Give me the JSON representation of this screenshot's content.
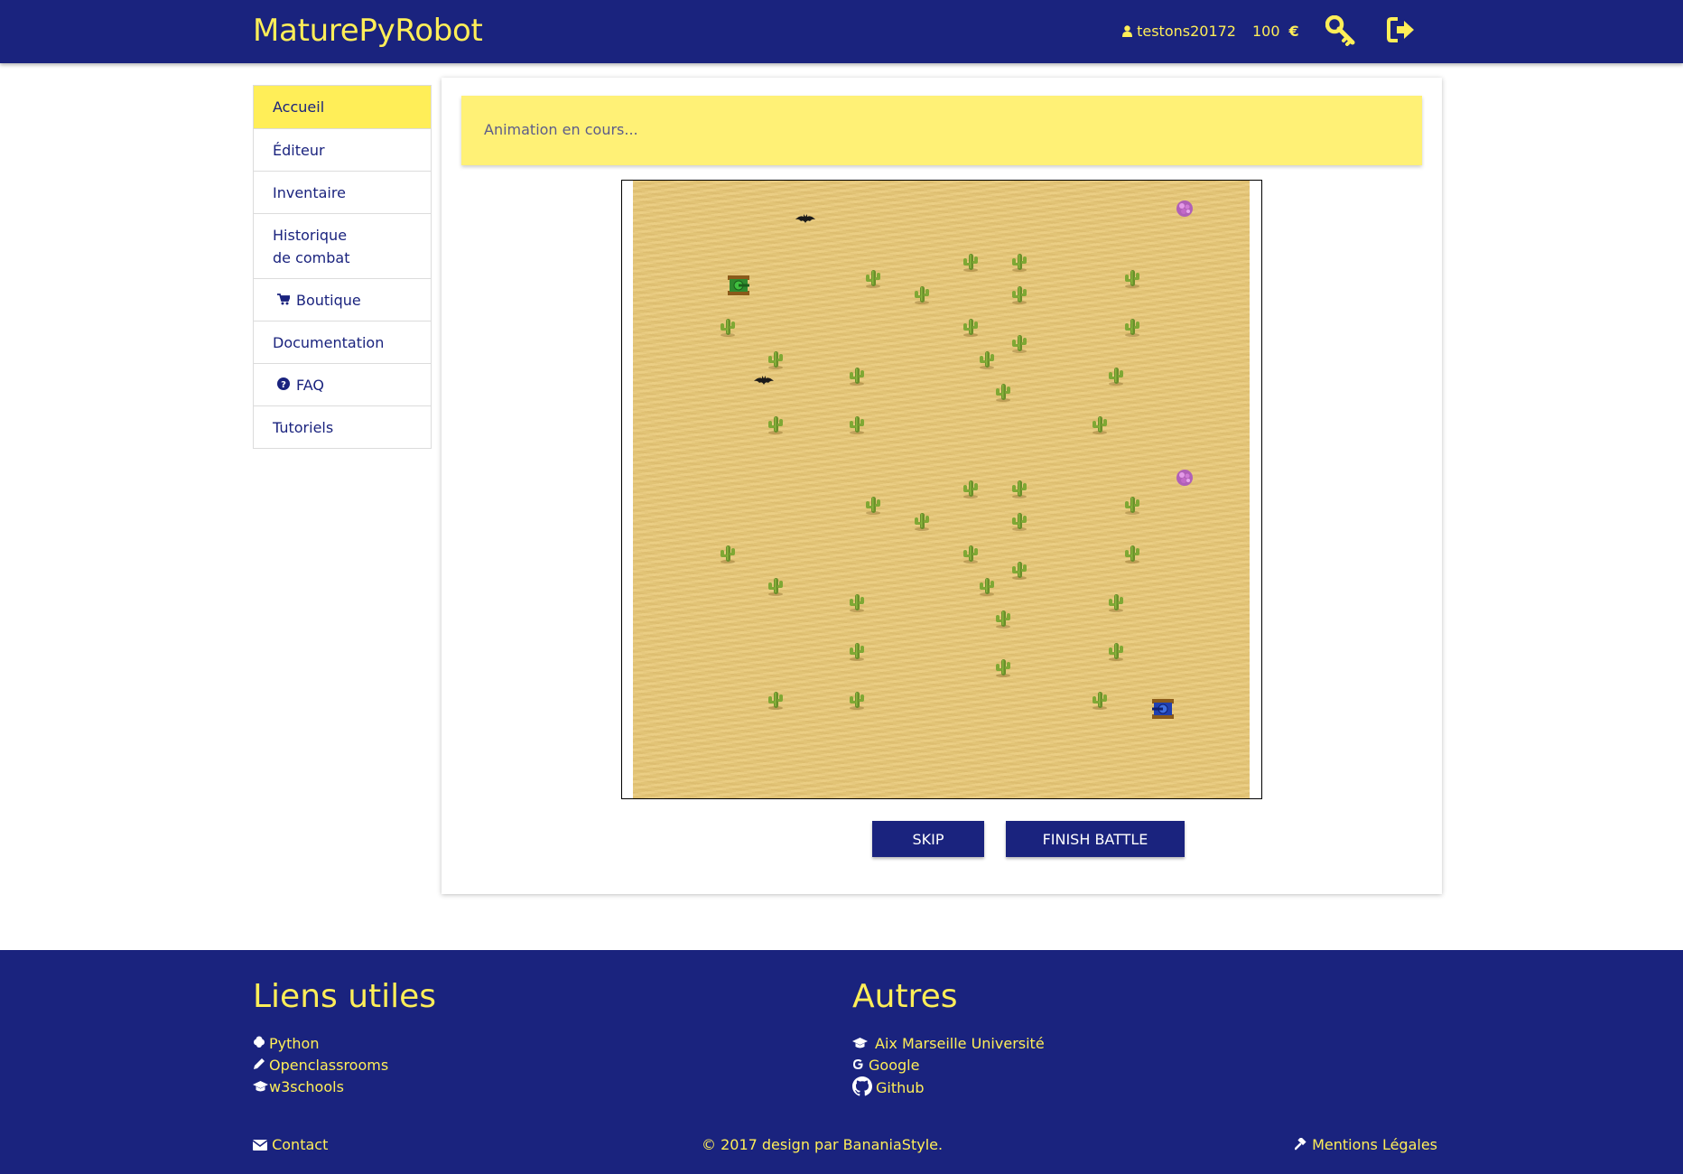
{
  "header": {
    "brand": "MaturePyRobot",
    "username": "testons20172",
    "money": "100",
    "currency": "€"
  },
  "sidebar": {
    "items": [
      {
        "label": "Accueil",
        "active": true
      },
      {
        "label": "Éditeur"
      },
      {
        "label": "Inventaire"
      },
      {
        "label_line1": "Historique",
        "label_line2": "de combat"
      },
      {
        "label": "Boutique",
        "icon": "cart-icon"
      },
      {
        "label": "Documentation"
      },
      {
        "label": "FAQ",
        "icon": "question-circle-icon"
      },
      {
        "label": "Tutoriels"
      }
    ]
  },
  "main": {
    "alert_text": "Animation en cours...",
    "skip_label": "SKIP",
    "finish_label": "FINISH BATTLE"
  },
  "footer": {
    "useful_title": "Liens utiles",
    "useful_links": [
      {
        "label": "Python",
        "icon": "python-icon"
      },
      {
        "label": "Openclassrooms",
        "icon": "pencil-icon"
      },
      {
        "label": "w3schools",
        "icon": "graduation-cap-icon"
      }
    ],
    "others_title": "Autres",
    "other_links": [
      {
        "label": "Aix Marseille Université",
        "icon": "graduation-cap-icon"
      },
      {
        "label": "Google",
        "icon": "google-icon"
      },
      {
        "label": "Github",
        "icon": "github-icon"
      }
    ],
    "contact": "Contact",
    "copyright": "© 2017 design par BananiaStyle.",
    "legal": "Mentions Légales"
  },
  "colors": {
    "primary": "#1a237e",
    "accent": "#ffee58",
    "alert": "#fff176",
    "sand": "#e8c878"
  }
}
